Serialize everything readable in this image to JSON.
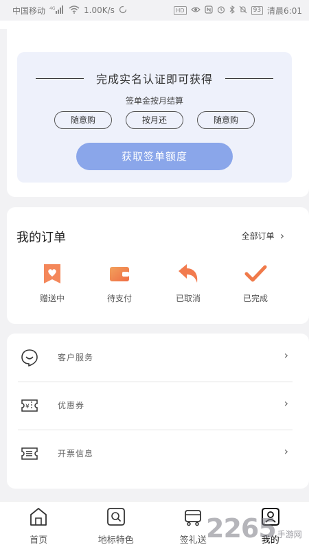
{
  "status_bar": {
    "carrier": "中国移动",
    "network": "4G",
    "speed": "1.00K/s",
    "hd_label": "HD",
    "battery": "93",
    "time": "清晨6:01"
  },
  "verify": {
    "title": "完成实名认证即可获得",
    "subtitle": "签单金按月结算",
    "pills": [
      "随意购",
      "按月还",
      "随意购"
    ],
    "button": "获取签单额度"
  },
  "orders": {
    "title": "我的订单",
    "all_label": "全部订单",
    "items": [
      {
        "label": "赠送中",
        "icon": "gift-bookmark-icon"
      },
      {
        "label": "待支付",
        "icon": "wallet-icon"
      },
      {
        "label": "已取消",
        "icon": "undo-arrow-icon"
      },
      {
        "label": "已完成",
        "icon": "checkmark-icon"
      }
    ]
  },
  "menu": {
    "items": [
      {
        "label": "客户服务",
        "icon": "customer-service-icon"
      },
      {
        "label": "优惠券",
        "icon": "coupon-icon"
      },
      {
        "label": "开票信息",
        "icon": "invoice-icon"
      }
    ]
  },
  "tabs": [
    {
      "label": "首页",
      "icon": "home-icon",
      "active": false
    },
    {
      "label": "地标特色",
      "icon": "landmark-search-icon",
      "active": false
    },
    {
      "label": "签礼送",
      "icon": "gift-cart-icon",
      "active": false
    },
    {
      "label": "我的",
      "icon": "profile-icon",
      "active": true
    }
  ],
  "watermark": {
    "number": "2265",
    "text": "手游网"
  },
  "colors": {
    "primary_button": "#8aa6ea",
    "panel_bg": "#eef1fb",
    "accent_orange": "#f07a4a",
    "page_bg": "#f2f2f4"
  }
}
